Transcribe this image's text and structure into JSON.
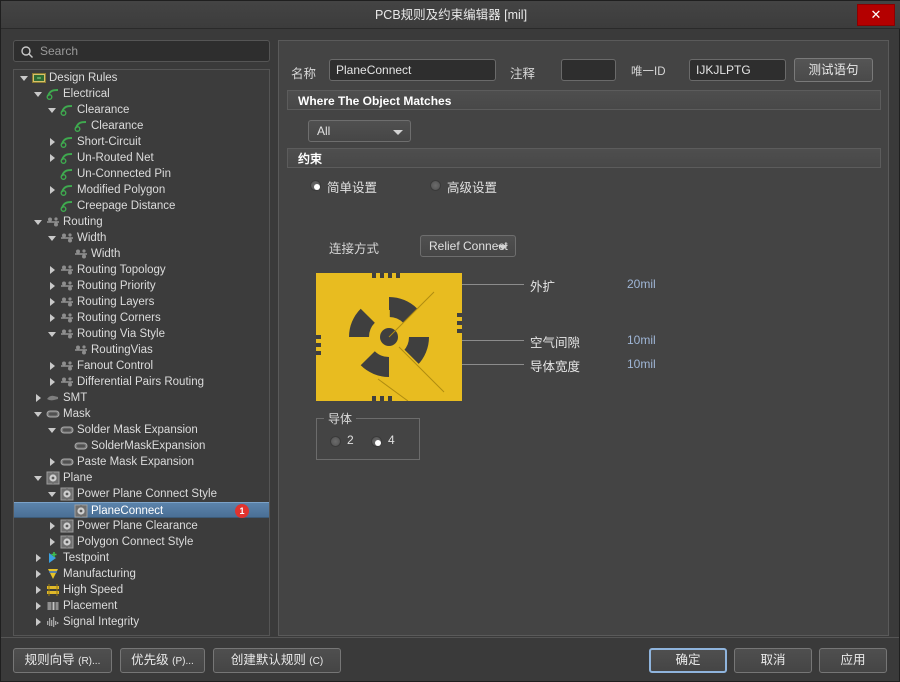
{
  "window": {
    "title": "PCB规则及约束编辑器 [mil]",
    "close_label": "✕",
    "close_icon": "close-icon"
  },
  "search": {
    "placeholder": "Search",
    "value": "",
    "icon": "search-icon"
  },
  "tree": {
    "items": [
      {
        "label": "Design Rules",
        "depth": 0,
        "arrow": "down",
        "icon": "design-rules-icon",
        "selected": false
      },
      {
        "label": "Electrical",
        "depth": 1,
        "arrow": "down",
        "icon": "electrical-icon",
        "selected": false
      },
      {
        "label": "Clearance",
        "depth": 2,
        "arrow": "down",
        "icon": "electrical-icon",
        "selected": false
      },
      {
        "label": "Clearance",
        "depth": 3,
        "arrow": "none",
        "icon": "electrical-icon",
        "selected": false
      },
      {
        "label": "Short-Circuit",
        "depth": 2,
        "arrow": "right",
        "icon": "electrical-icon",
        "selected": false
      },
      {
        "label": "Un-Routed Net",
        "depth": 2,
        "arrow": "right",
        "icon": "electrical-icon",
        "selected": false
      },
      {
        "label": "Un-Connected Pin",
        "depth": 2,
        "arrow": "none",
        "icon": "electrical-icon",
        "selected": false
      },
      {
        "label": "Modified Polygon",
        "depth": 2,
        "arrow": "right",
        "icon": "electrical-icon",
        "selected": false
      },
      {
        "label": "Creepage Distance",
        "depth": 2,
        "arrow": "none",
        "icon": "electrical-icon",
        "selected": false
      },
      {
        "label": "Routing",
        "depth": 1,
        "arrow": "down",
        "icon": "routing-icon",
        "selected": false
      },
      {
        "label": "Width",
        "depth": 2,
        "arrow": "down",
        "icon": "routing-icon",
        "selected": false
      },
      {
        "label": "Width",
        "depth": 3,
        "arrow": "none",
        "icon": "routing-icon",
        "selected": false
      },
      {
        "label": "Routing Topology",
        "depth": 2,
        "arrow": "right",
        "icon": "routing-icon",
        "selected": false
      },
      {
        "label": "Routing Priority",
        "depth": 2,
        "arrow": "right",
        "icon": "routing-icon",
        "selected": false
      },
      {
        "label": "Routing Layers",
        "depth": 2,
        "arrow": "right",
        "icon": "routing-icon",
        "selected": false
      },
      {
        "label": "Routing Corners",
        "depth": 2,
        "arrow": "right",
        "icon": "routing-icon",
        "selected": false
      },
      {
        "label": "Routing Via Style",
        "depth": 2,
        "arrow": "down",
        "icon": "routing-icon",
        "selected": false
      },
      {
        "label": "RoutingVias",
        "depth": 3,
        "arrow": "none",
        "icon": "routing-icon",
        "selected": false
      },
      {
        "label": "Fanout Control",
        "depth": 2,
        "arrow": "right",
        "icon": "routing-icon",
        "selected": false
      },
      {
        "label": "Differential Pairs Routing",
        "depth": 2,
        "arrow": "right",
        "icon": "routing-icon",
        "selected": false
      },
      {
        "label": "SMT",
        "depth": 1,
        "arrow": "right",
        "icon": "smt-icon",
        "selected": false
      },
      {
        "label": "Mask",
        "depth": 1,
        "arrow": "down",
        "icon": "mask-icon",
        "selected": false
      },
      {
        "label": "Solder Mask Expansion",
        "depth": 2,
        "arrow": "down",
        "icon": "mask-icon",
        "selected": false
      },
      {
        "label": "SolderMaskExpansion",
        "depth": 3,
        "arrow": "none",
        "icon": "mask-icon",
        "selected": false
      },
      {
        "label": "Paste Mask Expansion",
        "depth": 2,
        "arrow": "right",
        "icon": "mask-icon",
        "selected": false
      },
      {
        "label": "Plane",
        "depth": 1,
        "arrow": "down",
        "icon": "plane-icon",
        "selected": false
      },
      {
        "label": "Power Plane Connect Style",
        "depth": 2,
        "arrow": "down",
        "icon": "plane-icon",
        "selected": false
      },
      {
        "label": "PlaneConnect",
        "depth": 3,
        "arrow": "none",
        "icon": "plane-icon",
        "selected": true,
        "badge": "1"
      },
      {
        "label": "Power Plane Clearance",
        "depth": 2,
        "arrow": "right",
        "icon": "plane-icon",
        "selected": false
      },
      {
        "label": "Polygon Connect Style",
        "depth": 2,
        "arrow": "right",
        "icon": "plane-icon",
        "selected": false
      },
      {
        "label": "Testpoint",
        "depth": 1,
        "arrow": "right",
        "icon": "testpoint-icon",
        "selected": false
      },
      {
        "label": "Manufacturing",
        "depth": 1,
        "arrow": "right",
        "icon": "manufacturing-icon",
        "selected": false
      },
      {
        "label": "High Speed",
        "depth": 1,
        "arrow": "right",
        "icon": "highspeed-icon",
        "selected": false
      },
      {
        "label": "Placement",
        "depth": 1,
        "arrow": "right",
        "icon": "placement-icon",
        "selected": false
      },
      {
        "label": "Signal Integrity",
        "depth": 1,
        "arrow": "right",
        "icon": "signalintegrity-icon",
        "selected": false
      }
    ]
  },
  "form": {
    "name_label": "名称",
    "name_value": "PlaneConnect",
    "comment_label": "注释",
    "comment_value": "",
    "uid_label": "唯一ID",
    "uid_value": "IJKJLPTG",
    "test_button": "测试语句"
  },
  "where_section": {
    "title": "Where The Object Matches",
    "scope_value": "All"
  },
  "constraint_section": {
    "title": "约束",
    "simple_label": "简单设置",
    "simple_selected": true,
    "advanced_label": "高级设置",
    "advanced_selected": false,
    "connect_style_label": "连接方式",
    "connect_style_value": "Relief Connect",
    "dims": [
      {
        "label": "外扩",
        "value": "20mil"
      },
      {
        "label": "空气间隙",
        "value": "10mil"
      },
      {
        "label": "导体宽度",
        "value": "10mil"
      }
    ],
    "conductors_legend": "导体",
    "conductors_options": [
      {
        "label": "2",
        "selected": false
      },
      {
        "label": "4",
        "selected": true
      }
    ]
  },
  "footer": {
    "wizard_button": "规则向导 (R)...",
    "priority_button": "优先级 (P)...",
    "create_default_button": "创建默认规则 (C)",
    "ok_button": "确定",
    "cancel_button": "取消",
    "apply_button": "应用"
  },
  "colors": {
    "pad_yellow": "#e8bc20",
    "accent_blue": "#5b83ab",
    "badge_red": "#e0332e",
    "close_red": "#b40000",
    "value_blue": "#9fb6d6"
  }
}
